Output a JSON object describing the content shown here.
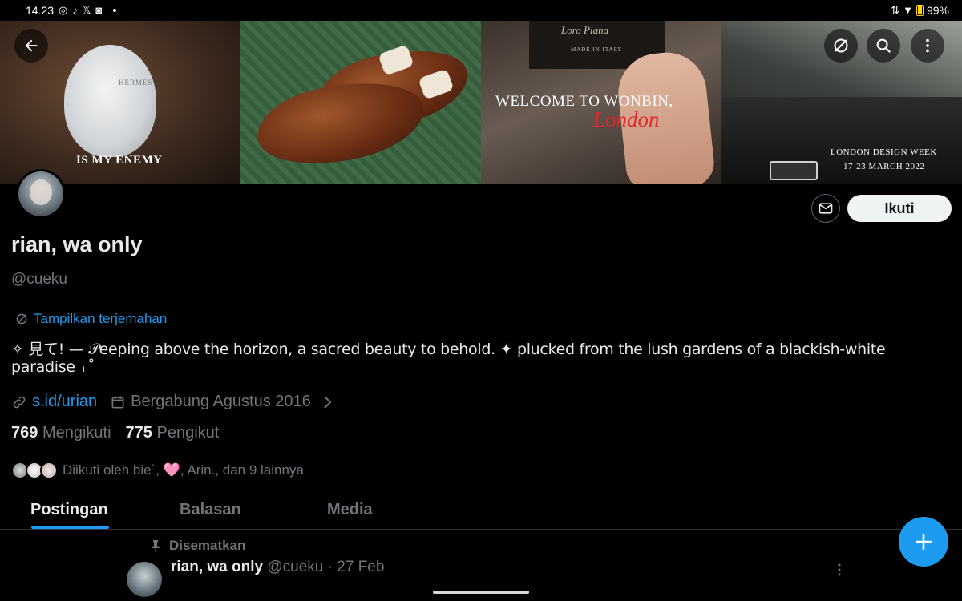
{
  "status_bar": {
    "time": "14.23",
    "battery": "99%",
    "icons": [
      "whatsapp-icon",
      "tiktok-icon",
      "x-icon",
      "instagram-icon",
      "dot-icon",
      "signal-icon",
      "wifi-icon",
      "battery-icon"
    ]
  },
  "banner": {
    "panel1_caption": "IS MY ENEMY",
    "panel1_brand": "HERMÈS",
    "panel3_brand": "Loro Piana",
    "panel3_made_in": "MADE IN ITALY",
    "panel3_welcome": "WELCOME TO WONBIN,",
    "panel3_city": "London",
    "panel4_event": "LONDON DESIGN WEEK",
    "panel4_dates": "17-23 MARCH 2022"
  },
  "profile": {
    "name": "rian, wa only",
    "handle": "@cueku",
    "translate_label": "Tampilkan terjemahan",
    "bio": "✧ 見て! — 𝒫eeping above the horizon, a sacred beauty to behold. ✦ plucked from the lush gardens of a blackish-white paradise ₊˚",
    "link": "s.id/urian",
    "joined": "Bergabung Agustus 2016",
    "following_count": "769",
    "following_label": "Mengikuti",
    "followers_count": "775",
    "followers_label": "Pengikut",
    "followed_by_prefix": "Diikuti oleh bie`,",
    "followed_by_heart": "🩷",
    "followed_by_suffix": ", Arin., dan 9 lainnya"
  },
  "actions": {
    "follow_label": "Ikuti"
  },
  "tabs": [
    {
      "label": "Postingan",
      "active": true
    },
    {
      "label": "Balasan",
      "active": false
    },
    {
      "label": "Media",
      "active": false
    }
  ],
  "pinned_post": {
    "pinned_label": "Disematkan",
    "author_name": "rian, wa only",
    "author_handle": "@cueku",
    "date": "· 27 Feb"
  },
  "colors": {
    "accent": "#1d9bf0",
    "background": "#000000",
    "muted": "#71767b"
  }
}
